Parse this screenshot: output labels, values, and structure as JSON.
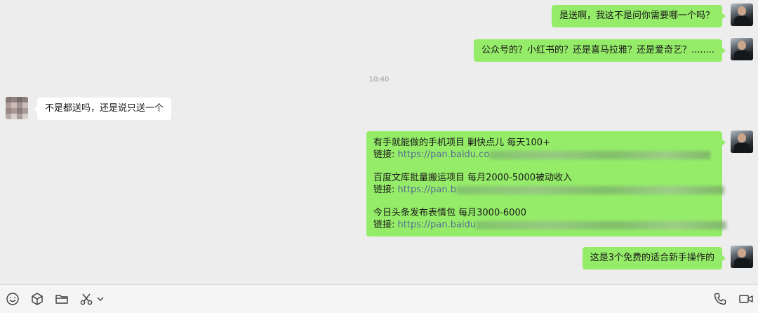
{
  "messages": [
    {
      "sender": "me",
      "text": "是送啊，我这不是问你需要哪一个吗？"
    },
    {
      "sender": "me",
      "text": "公众号的？小红书的？还是喜马拉雅？还是爱奇艺？........"
    },
    {
      "sender": "other",
      "text": "不是都送吗，还是说只送一个"
    },
    {
      "sender": "me",
      "type": "links",
      "items": [
        {
          "title": "有手就能做的手机项目 剿快点儿 每天100+",
          "link_label": "链接:",
          "link_text": "https://pan.baidu.co"
        },
        {
          "title": "百度文库批量搬运项目 每月2000-5000被动收入",
          "link_label": "链接:",
          "link_text": "https://pan.b"
        },
        {
          "title": "今日头条发布表情包 每月3000-6000",
          "link_label": "链接:",
          "link_text": "https://pan.baidu"
        }
      ]
    },
    {
      "sender": "me",
      "text": "这是3个免费的适合新手操作的"
    }
  ],
  "timestamp": "10:40",
  "toolbar": {
    "left": [
      "emoji-icon",
      "box-icon",
      "folder-icon",
      "scissors-icon",
      "chevron-down-icon"
    ],
    "right": [
      "phone-icon",
      "video-icon"
    ]
  },
  "colors": {
    "background": "#ededed",
    "my_bubble": "#95ec69",
    "other_bubble": "#ffffff",
    "link": "#576b95"
  }
}
